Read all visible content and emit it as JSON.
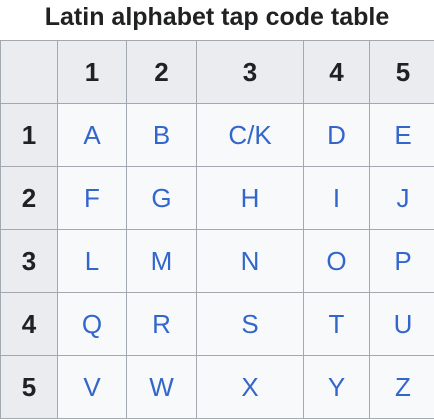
{
  "caption": "Latin alphabet tap code table",
  "header": {
    "corner": "",
    "cols": [
      "1",
      "2",
      "3",
      "4",
      "5"
    ]
  },
  "rows": [
    {
      "label": "1",
      "cells": [
        "A",
        "B",
        "C/K",
        "D",
        "E"
      ]
    },
    {
      "label": "2",
      "cells": [
        "F",
        "G",
        "H",
        "I",
        "J"
      ]
    },
    {
      "label": "3",
      "cells": [
        "L",
        "M",
        "N",
        "O",
        "P"
      ]
    },
    {
      "label": "4",
      "cells": [
        "Q",
        "R",
        "S",
        "T",
        "U"
      ]
    },
    {
      "label": "5",
      "cells": [
        "V",
        "W",
        "X",
        "Y",
        "Z"
      ]
    }
  ],
  "colors": {
    "header_bg": "#eaecf0",
    "cell_bg": "#f8f9fa",
    "border": "#a2a9b1",
    "link_text": "#3366cc",
    "header_text": "#202122"
  }
}
